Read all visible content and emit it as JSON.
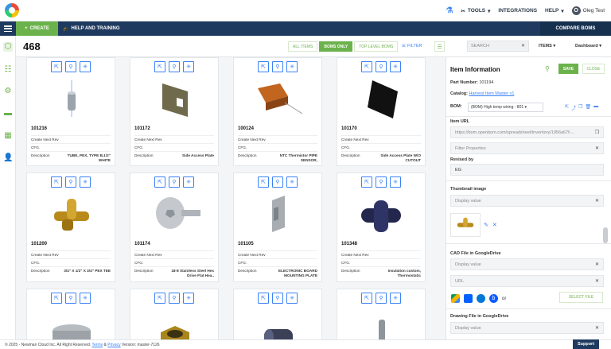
{
  "topbar": {
    "tools_label": "TOOLS",
    "integrations_label": "INTEGRATIONS",
    "help_label": "HELP",
    "user_name": "Oleg Test",
    "avatar_initial": "O"
  },
  "nav": {
    "create_label": "CREATE",
    "help_training_label": "HELP AND TRAINING",
    "compare_label": "COMPARE BOMS"
  },
  "subheader": {
    "count": "468",
    "filter_all": "ALL ITEMS",
    "filter_boms": "BOMS ONLY",
    "filter_top": "TOP LEVEL BOMS",
    "filter_label": "FILTER",
    "search_placeholder": "SEARCH",
    "items_label": "ITEMS",
    "dashboard_label": "Dashboard"
  },
  "cards": [
    {
      "pn": "101216",
      "rev": "Create Next Rev",
      "cfg": "CFG.",
      "desc_label": "Description",
      "desc": "TUBE, PEX, TYPE B,1/2\" WHITE"
    },
    {
      "pn": "101172",
      "rev": "Create Next Rev",
      "cfg": "CFG.",
      "desc_label": "Description",
      "desc": "Side Access Plate"
    },
    {
      "pn": "100124",
      "rev": "Create Next Rev",
      "cfg": "CFG.",
      "desc_label": "Description",
      "desc": "NTC Thermistor PIPE SENSOR,"
    },
    {
      "pn": "101170",
      "rev": "Create Next Rev",
      "cfg": "CFG.",
      "desc_label": "Description",
      "desc": "Side Access Plate W/O CUTOUT"
    },
    {
      "pn": "101200",
      "rev": "Create Next Rev",
      "cfg": "CFG.",
      "desc_label": "Description",
      "desc": "3/4\" X 1/2\" X 3/4\" PEX TEE"
    },
    {
      "pn": "101174",
      "rev": "Create Next Rev",
      "cfg": "CFG.",
      "desc_label": "Description",
      "desc": "18-8 Stainless Steel Hex Drive Flat Hea.."
    },
    {
      "pn": "101105",
      "rev": "Create Next Rev",
      "cfg": "CFG.",
      "desc_label": "Description",
      "desc": "ELECTRONIC BOARD MOUNTING PLATE"
    },
    {
      "pn": "101348",
      "rev": "Create Next Rev",
      "cfg": "CFG.",
      "desc_label": "Description",
      "desc": "Insulation custom, Thermostatic"
    }
  ],
  "panel": {
    "title": "Item Information",
    "save_label": "SAVE",
    "close_label": "CLOSE",
    "part_number_label": "Part Number:",
    "part_number": "101194",
    "catalog_label": "Catalog:",
    "catalog_link": "Harvest Item Master v1",
    "bom_label": "BOM:",
    "bom_value": "(BOM) High temp wiring - 801",
    "item_url_label": "Item URL",
    "item_url": "https://bom.openbom.com/spreadsheet/inventory/1956a67f-...",
    "filter_props_placeholder": "Filter Properties",
    "revised_by_label": "Revised by",
    "revised_by": "EG",
    "thumb_label": "Thumbnail image",
    "display_value": "Display value",
    "cad_label": "CAD File in GoogleDrive",
    "url_placeholder": "URL",
    "or_label": "or",
    "select_file_label": "SELECT FILE",
    "drawing_label": "Drawing File in GoogleDrive"
  },
  "footer": {
    "copyright": "© 2025 - Newman Cloud Inc. All Right Reserved.",
    "terms": "Terms",
    "amp": "&",
    "privacy": "Privacy",
    "version": "Version: master-7126",
    "support_label": "Support"
  }
}
